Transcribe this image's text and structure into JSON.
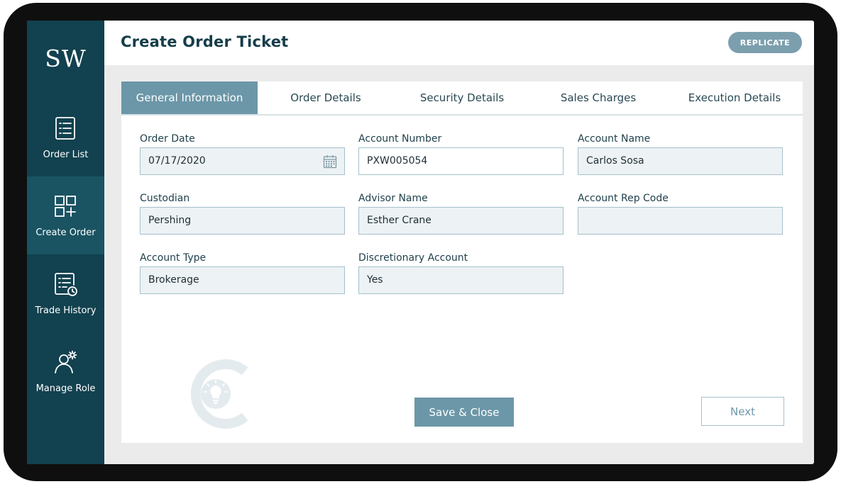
{
  "app": {
    "logo": "SW"
  },
  "sidebar": {
    "items": [
      {
        "label": "Order List",
        "icon": "list-icon",
        "active": false
      },
      {
        "label": "Create Order",
        "icon": "create-order-icon",
        "active": true
      },
      {
        "label": "Trade History",
        "icon": "trade-history-icon",
        "active": false
      },
      {
        "label": "Manage Role",
        "icon": "manage-role-icon",
        "active": false
      }
    ]
  },
  "header": {
    "title": "Create Order Ticket",
    "replicate_label": "REPLICATE"
  },
  "tabs": [
    {
      "label": "General Information",
      "active": true
    },
    {
      "label": "Order Details",
      "active": false
    },
    {
      "label": "Security Details",
      "active": false
    },
    {
      "label": "Sales Charges",
      "active": false
    },
    {
      "label": "Execution Details",
      "active": false
    }
  ],
  "form": {
    "order_date": {
      "label": "Order Date",
      "value": "07/17/2020",
      "icon": "calendar-icon"
    },
    "account_number": {
      "label": "Account Number",
      "value": "PXW005054"
    },
    "account_name": {
      "label": "Account Name",
      "value": "Carlos Sosa"
    },
    "custodian": {
      "label": "Custodian",
      "value": "Pershing"
    },
    "advisor_name": {
      "label": "Advisor Name",
      "value": "Esther Crane"
    },
    "account_rep_code": {
      "label": "Account Rep Code",
      "value": ""
    },
    "account_type": {
      "label": "Account Type",
      "value": "Brokerage"
    },
    "discretionary_account": {
      "label": "Discretionary Account",
      "value": "Yes"
    }
  },
  "actions": {
    "save_close_label": "Save & Close",
    "next_label": "Next"
  },
  "colors": {
    "sidebar_bg": "#12414f",
    "sidebar_active_bg": "#1a5362",
    "accent": "#6c97a8",
    "replicate_bg": "#7c9fae",
    "field_bg": "#edf2f4",
    "field_border": "#a6c0cb",
    "title": "#163d4a"
  }
}
